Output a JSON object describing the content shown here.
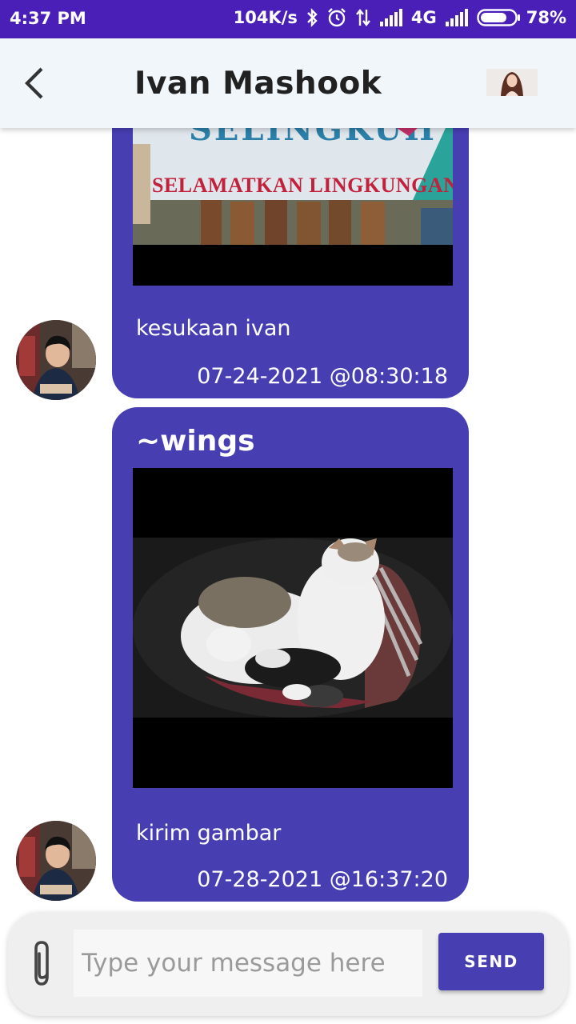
{
  "status_bar": {
    "time": "4:37 PM",
    "network_speed": "104K/s",
    "network_type": "4G",
    "battery_percent": "78%",
    "battery_level": 0.78,
    "icons": [
      "bluetooth-icon",
      "alarm-icon",
      "data-transfer-icon",
      "signal-icon",
      "signal-icon",
      "battery-icon"
    ]
  },
  "header": {
    "title": "Ivan Mashook",
    "back_icon": "chevron-left-icon",
    "avatar": "contact-avatar"
  },
  "messages": [
    {
      "sender": "",
      "image": "banner-photo",
      "image_text": "SELINGKUH / SELAMATKAN LINGKUNGAN HIDUP",
      "text": "kesukaan ivan",
      "timestamp": "07-24-2021 @08:30:18"
    },
    {
      "sender": "~wings",
      "image": "cats-photo",
      "text": "kirim gambar",
      "timestamp": "07-28-2021 @16:37:20"
    }
  ],
  "composer": {
    "placeholder": "Type your message here",
    "value": "",
    "send_label": "SEND",
    "attach_icon": "paperclip-icon"
  },
  "colors": {
    "status_bar": "#4a1fb8",
    "app_bar": "#f0f6fa",
    "bubble": "#473eb2",
    "send_button": "#473eb2"
  }
}
